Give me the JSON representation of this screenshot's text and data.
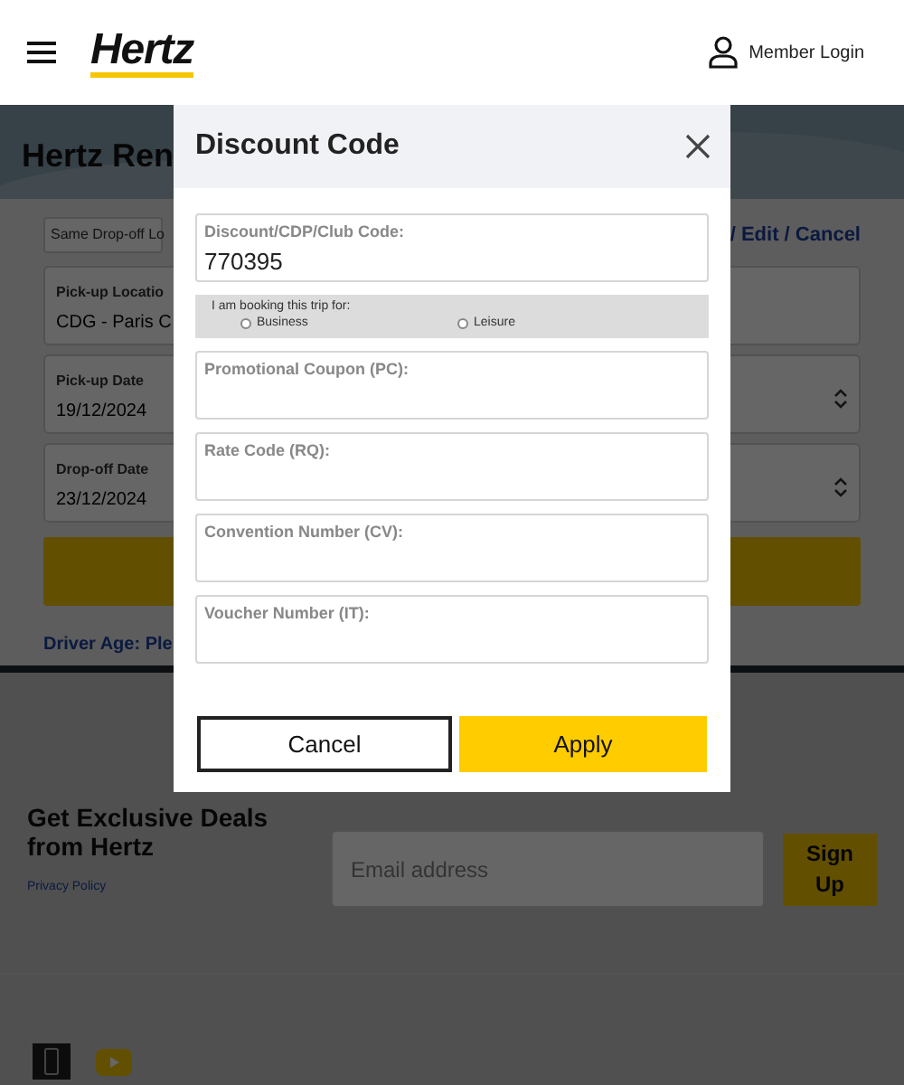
{
  "header": {
    "logo": "Hertz",
    "member_login": "Member Login"
  },
  "background_page": {
    "title": "Hertz Ren",
    "drop_off_select": "Same Drop-off Lo",
    "manage_link": "/ Edit / Cancel",
    "fields": [
      {
        "kind": "text",
        "label": "Pick-up Locatio",
        "value": "CDG - Paris C"
      },
      {
        "kind": "date",
        "label": "Pick-up Date",
        "value": "19/12/2024"
      },
      {
        "kind": "date",
        "label": "Drop-off Date",
        "value": "23/12/2024"
      }
    ],
    "driver_age": "Driver Age: Ple"
  },
  "newsletter": {
    "heading": "Get Exclusive Deals from Hertz",
    "privacy_link": "Privacy Policy",
    "email_placeholder": "Email address",
    "button": "Sign Up"
  },
  "modal": {
    "title": "Discount Code",
    "fields": [
      {
        "kind": "input",
        "label": "Discount/CDP/Club Code:",
        "value": "770395"
      },
      {
        "kind": "radios",
        "prompt": "I am booking this trip for:",
        "options": [
          {
            "label": "Business",
            "selected": false
          },
          {
            "label": "Leisure",
            "selected": false
          }
        ]
      },
      {
        "kind": "input",
        "label": "Promotional Coupon (PC):"
      },
      {
        "kind": "input",
        "label": "Rate Code (RQ):"
      },
      {
        "kind": "input",
        "label": "Convention Number (CV):"
      },
      {
        "kind": "input",
        "label": "Voucher Number (IT):"
      }
    ],
    "buttons": [
      {
        "kind": "secondary",
        "label": "Cancel"
      },
      {
        "kind": "primary",
        "label": "Apply"
      }
    ]
  }
}
